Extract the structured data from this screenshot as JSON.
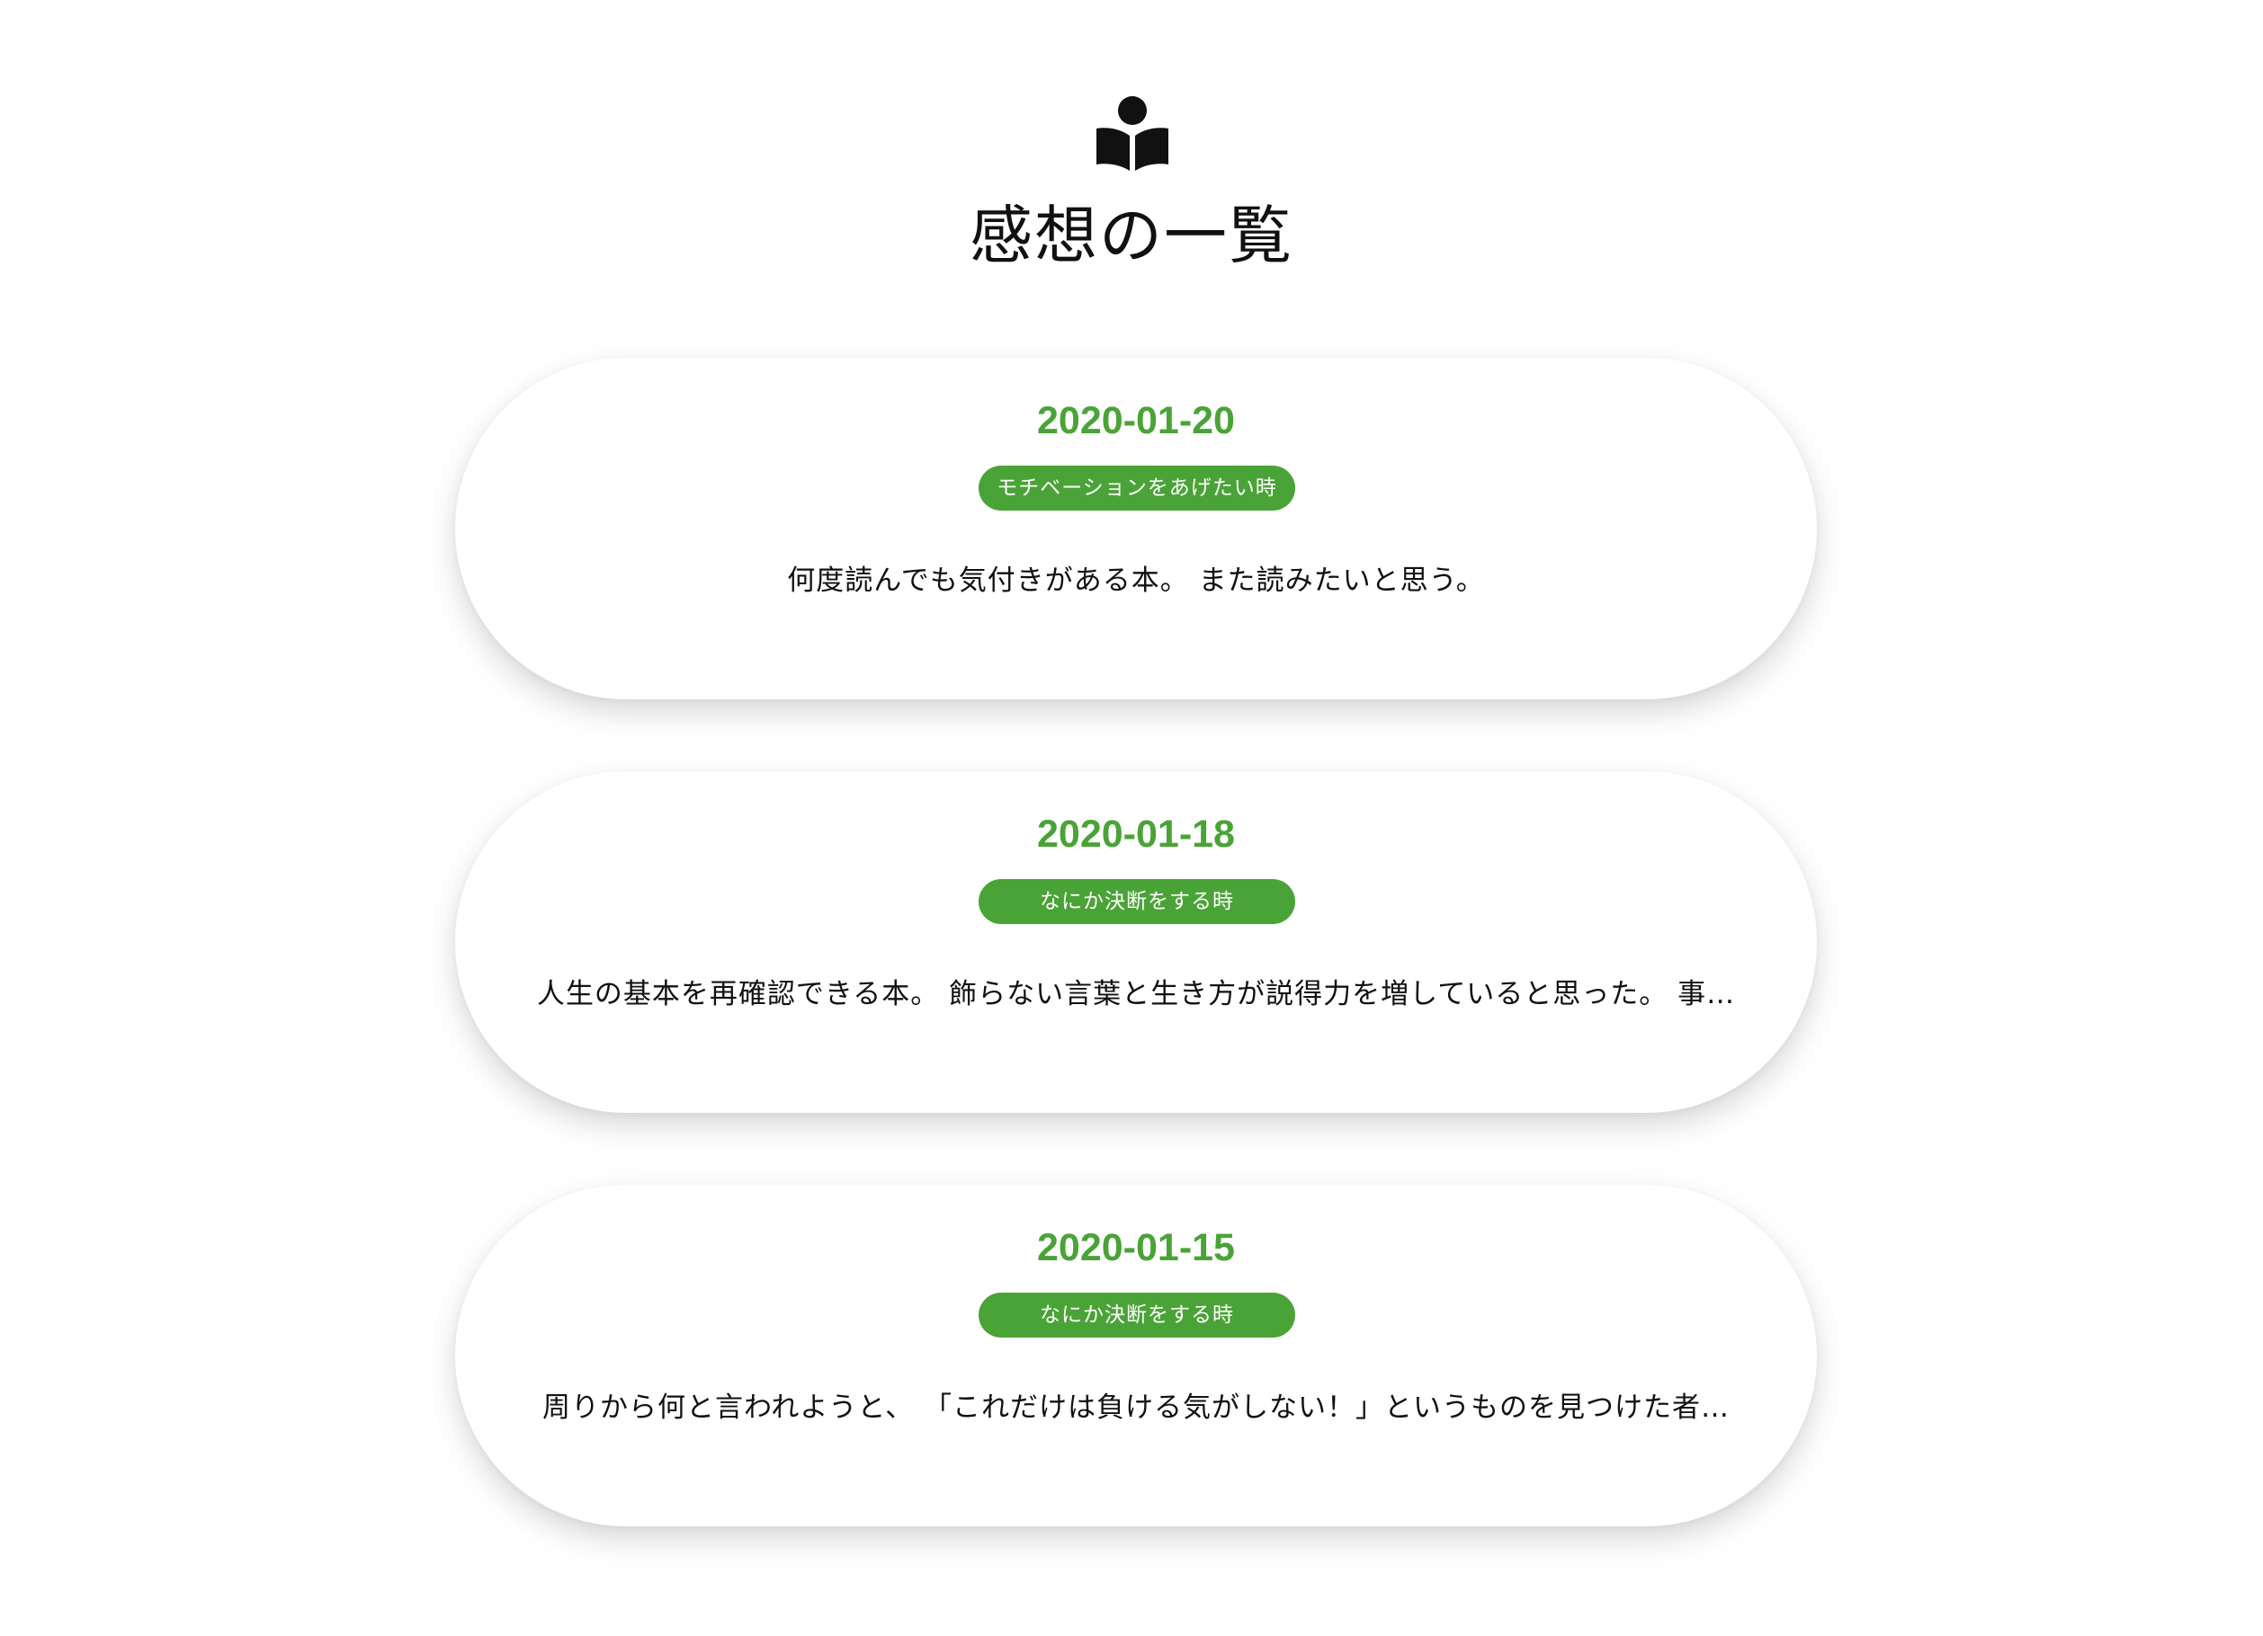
{
  "header": {
    "icon": "book-reader-icon",
    "title": "感想の一覧"
  },
  "colors": {
    "accent": "#4aa336",
    "text": "#111111",
    "background": "#ffffff"
  },
  "reviews": [
    {
      "date": "2020-01-20",
      "tag": "モチベーションをあげたい時",
      "text": "何度読んでも気付きがある本。 また読みたいと思う。"
    },
    {
      "date": "2020-01-18",
      "tag": "なにか決断をする時",
      "text": "人生の基本を再確認できる本。 飾らない言葉と生き方が説得力を増していると思った。 事…"
    },
    {
      "date": "2020-01-15",
      "tag": "なにか決断をする時",
      "text": "周りから何と言われようと、 「これだけは負ける気がしない！」というものを見つけた者…"
    }
  ]
}
